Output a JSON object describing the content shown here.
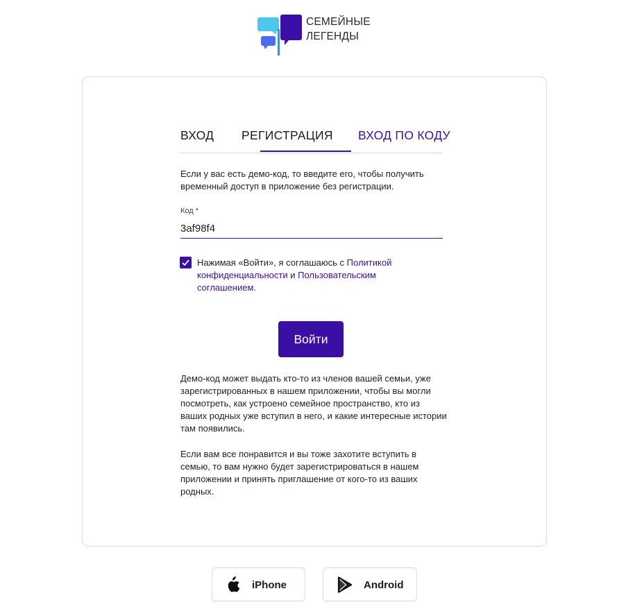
{
  "app": {
    "logo_line1": "СЕМЕЙНЫЕ",
    "logo_line2": "ЛЕГЕНДЫ"
  },
  "tabs": [
    {
      "label": "ВХОД",
      "active": false
    },
    {
      "label": "РЕГИСТРАЦИЯ",
      "active": false
    },
    {
      "label": "ВХОД ПО КОДУ",
      "active": true
    }
  ],
  "intro_text": "Если у вас есть демо-код, то введите его, чтобы получить временный доступ в приложение без регистрации.",
  "code_field": {
    "label": "Код *",
    "value": "3af98f4"
  },
  "consent": {
    "checked": true,
    "text_before": "Нажимая «Войти», я соглашаюсь с ",
    "privacy_link": "Политикой конфиденциальности",
    "text_and": " и ",
    "terms_link": "Пользовательским соглашением",
    "text_after": "."
  },
  "submit_label": "Войти",
  "info_paragraph_1": "Демо-код может выдать кто-то из членов вашей семьи, уже зарегистрированных в нашем приложении, чтобы вы могли посмотреть, как устроено семейное пространство, кто из ваших родных уже вступил в него, и какие интересные истории там появились.",
  "info_paragraph_2": "Если вам все понравится и вы тоже захотите вступить в семью, то вам нужно будет зарегистрироваться в нашем приложении и принять приглашение от кого-то из ваших родных.",
  "stores": {
    "iphone_label": "iPhone",
    "iphone_icon": "apple-icon",
    "android_label": "Android",
    "android_icon": "play-store-icon"
  },
  "colors": {
    "accent": "#3a0fa6",
    "logo_light_blue": "#4fc6ee",
    "logo_blue": "#4a6cf0",
    "logo_purple": "#3a0fa6",
    "border": "#dcdcdc"
  }
}
